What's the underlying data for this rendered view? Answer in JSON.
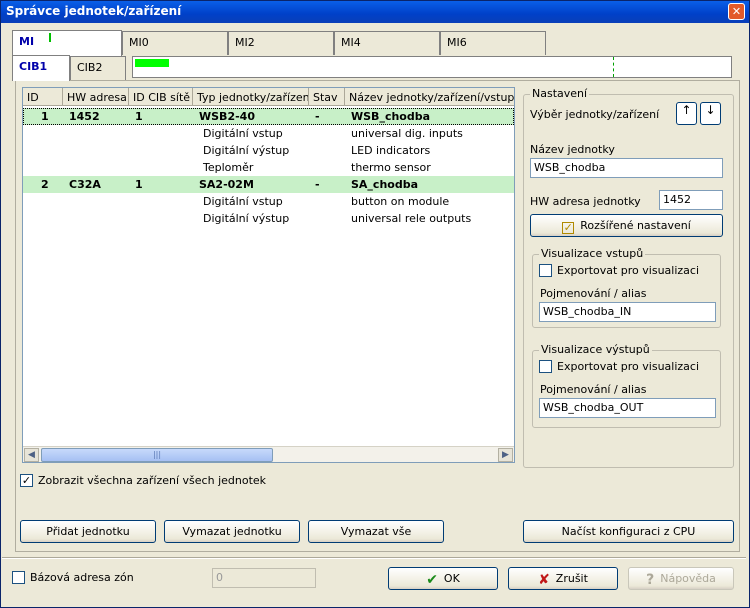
{
  "window": {
    "title": "Správce jednotek/zařízení",
    "close_symbol": "✕"
  },
  "mi_tabs": [
    "MI",
    "MI0",
    "MI2",
    "MI4",
    "MI6"
  ],
  "cib_tabs": [
    "CIB1",
    "CIB2"
  ],
  "table": {
    "columns": [
      "ID",
      "HW adresa",
      "ID CIB sítě",
      "Typ jednotky/zařízení",
      "Stav",
      "Název jednotky/zařízení/vstupu/v"
    ],
    "rows": [
      {
        "kind": "unit",
        "id": "1",
        "hw": "1452",
        "cib": "1",
        "type": "WSB2-40",
        "state": "-",
        "name": "WSB_chodba"
      },
      {
        "kind": "device",
        "type": "Digitální vstup",
        "name": "universal dig. inputs"
      },
      {
        "kind": "device",
        "type": "Digitální výstup",
        "name": "LED indicators"
      },
      {
        "kind": "device",
        "type": "Teploměr",
        "name": "thermo sensor"
      },
      {
        "kind": "unit",
        "id": "2",
        "hw": "C32A",
        "cib": "1",
        "type": "SA2-02M",
        "state": "-",
        "name": "SA_chodba"
      },
      {
        "kind": "device",
        "type": "Digitální vstup",
        "name": "button on module"
      },
      {
        "kind": "device",
        "type": "Digitální výstup",
        "name": "universal rele outputs"
      }
    ],
    "scroll_left": "◀",
    "scroll_right": "▶",
    "scroll_grip": "|||"
  },
  "settings": {
    "legend": "Nastavení",
    "unit_select_label": "Výběr jednotky/zařízení",
    "up_arrow": "↑",
    "down_arrow": "↓",
    "name_label": "Název jednotky",
    "name_value": "WSB_chodba",
    "hw_label": "HW adresa jednotky",
    "hw_value": "1452",
    "advanced_button": "Rozšířené nastavení",
    "inputs_group": {
      "legend": "Visualizace vstupů",
      "export_label": "Exportovat pro visualizaci",
      "alias_label": "Pojmenování / alias",
      "alias_value": "WSB_chodba_IN"
    },
    "outputs_group": {
      "legend": "Visualizace výstupů",
      "export_label": "Exportovat pro visualizaci",
      "alias_label": "Pojmenování / alias",
      "alias_value": "WSB_chodba_OUT"
    }
  },
  "show_all": {
    "label": "Zobrazit všechna zařízení všech jednotek",
    "check": "✓"
  },
  "buttons": {
    "add_unit": "Přidat jednotku",
    "delete_unit": "Vymazat jednotku",
    "delete_all": "Vymazat vše",
    "load_config": "Načíst konfiguraci z CPU",
    "ok": "OK",
    "cancel": "Zrušit",
    "help": "Nápověda"
  },
  "zone_base": {
    "label": "Bázová adresa zón",
    "value": "0"
  },
  "icons": {
    "ok": "✔",
    "cancel": "✘",
    "help": "?"
  },
  "colors": {
    "unit_row_bg": "#c8f0c8",
    "accent_green": "#00ff00",
    "ok_green": "#1a8a1a",
    "cancel_red": "#c01818"
  }
}
